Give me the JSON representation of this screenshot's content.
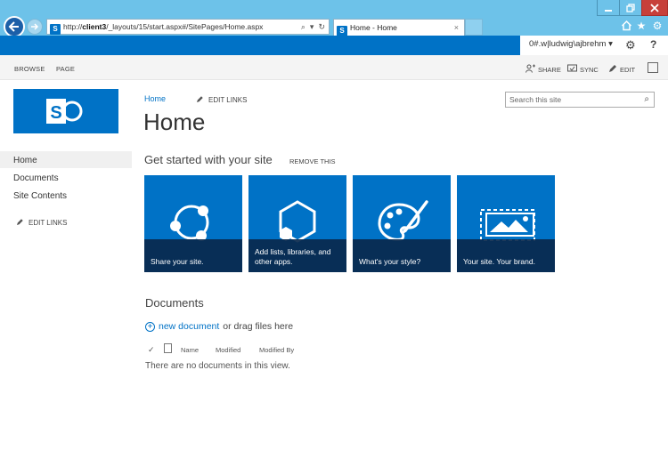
{
  "browser": {
    "url_prefix": "http://",
    "url_host": "client3",
    "url_path": "/_layouts/15/start.aspx#/SitePages/Home.aspx",
    "tab_title": "Home - Home",
    "tab_close": "×",
    "addr_search": "⌕",
    "addr_dropdown": "▾",
    "addr_refresh": "↻"
  },
  "suitebar": {
    "user": "0#.w|ludwig\\ajbrehm ▾",
    "help": "?"
  },
  "ribbon": {
    "tabs": [
      "BROWSE",
      "PAGE"
    ],
    "share": "SHARE",
    "sync": "SYNC",
    "edit": "EDIT"
  },
  "logo": {
    "letter": "S"
  },
  "leftnav": {
    "items": [
      "Home",
      "Documents",
      "Site Contents"
    ],
    "edit_links": "EDIT LINKS"
  },
  "header": {
    "breadcrumb": "Home",
    "edit_links": "EDIT LINKS",
    "title": "Home",
    "search_placeholder": "Search this site"
  },
  "get_started": {
    "title": "Get started with your site",
    "remove": "REMOVE THIS",
    "tiles": [
      {
        "caption": "Share your site."
      },
      {
        "caption": "Add lists, libraries, and other apps."
      },
      {
        "caption": "What's your style?"
      },
      {
        "caption": "Your site. Your brand."
      }
    ]
  },
  "documents": {
    "title": "Documents",
    "new_link": "new document",
    "new_suffix": "or drag files here",
    "columns": [
      "Name",
      "Modified",
      "Modified By"
    ],
    "empty": "There are no documents in this view."
  },
  "colors": {
    "brand": "#0072c6",
    "chrome": "#6dc2e9",
    "tile_caption": "#09284c",
    "close_red": "#c7403a"
  }
}
